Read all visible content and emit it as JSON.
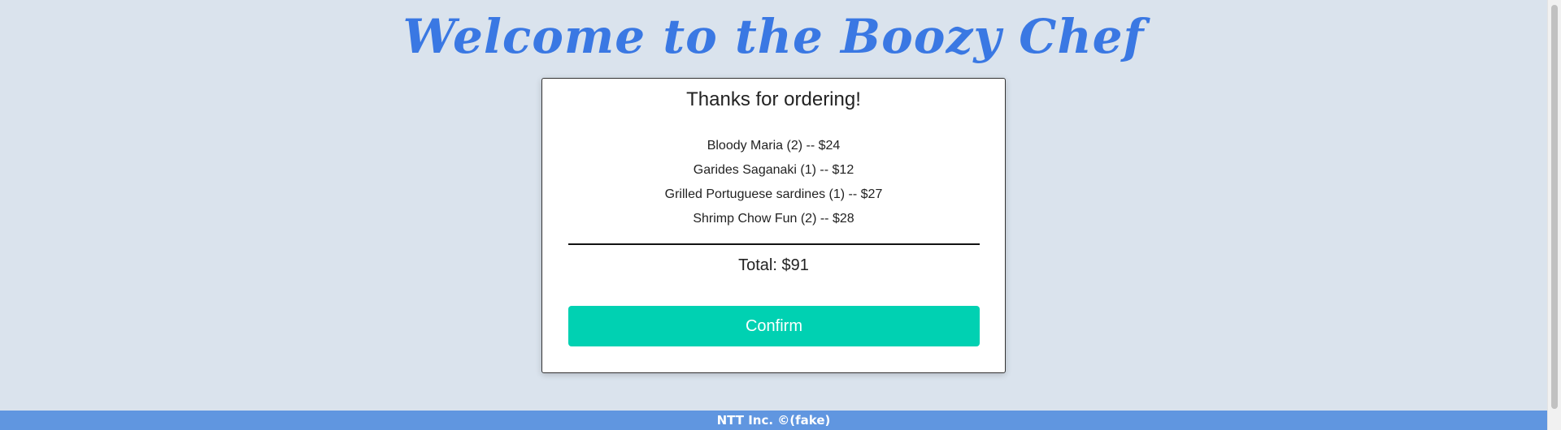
{
  "header": {
    "title": "Welcome to the Boozy Chef"
  },
  "order": {
    "heading": "Thanks for ordering!",
    "items": [
      {
        "text": "Bloody Maria (2) -- $24"
      },
      {
        "text": "Garides Saganaki (1) -- $12"
      },
      {
        "text": "Grilled Portuguese sardines (1) -- $27"
      },
      {
        "text": "Shrimp Chow Fun (2) -- $28"
      }
    ],
    "total": "Total: $91",
    "confirm_label": "Confirm"
  },
  "footer": {
    "text": "NTT Inc. ©(fake)"
  },
  "colors": {
    "background": "#dae3ed",
    "title": "#3a78e3",
    "button": "#00d1b2",
    "footer": "#6096e0"
  }
}
